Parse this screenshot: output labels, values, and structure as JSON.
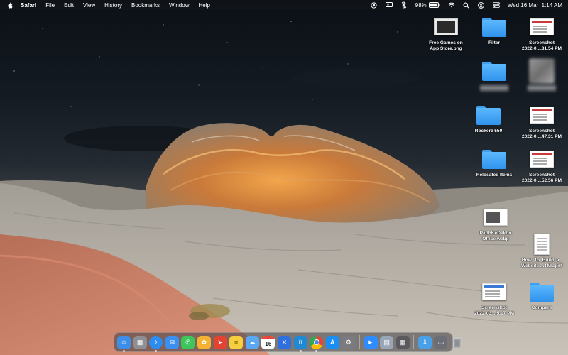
{
  "menubar": {
    "app_name": "Safari",
    "menus": [
      "File",
      "Edit",
      "View",
      "History",
      "Bookmarks",
      "Window",
      "Help"
    ],
    "battery": "98%",
    "datetime": "Wed 16 Mar  1:14 AM",
    "status_icons": [
      "screen-record-icon",
      "display-icon",
      "bluetooth-icon",
      "battery-icon",
      "wifi-icon",
      "search-icon",
      "user-icon",
      "control-center-icon"
    ]
  },
  "desktop": {
    "icons": [
      {
        "label": "Free Games on\nApp Store.png",
        "kind": "screenshot-dark"
      },
      {
        "label": "Filter",
        "kind": "folder"
      },
      {
        "label": "Screenshot\n2022-0....31.54 PM",
        "kind": "screenshot"
      },
      {
        "label": "",
        "kind": "folder-blurred"
      },
      {
        "label": "",
        "kind": "blurred"
      },
      {
        "label": "Rockerz 550",
        "kind": "folder"
      },
      {
        "label": "Screenshot\n2022-0....47.31 PM",
        "kind": "screenshot"
      },
      {
        "label": "Relocated Items",
        "kind": "folder"
      },
      {
        "label": "Screenshot\n2022-0....52.56 PM",
        "kind": "screenshot"
      },
      {
        "label": "PadhKeDekho\nOffice.webp",
        "kind": "screenshot-dark"
      },
      {
        "label": "How_To_Build_a_\nWebsite....TML.pdf",
        "kind": "pdf"
      },
      {
        "label": "Screenshot\n2022-03....5.17 PM",
        "kind": "screenshot"
      },
      {
        "label": "Compare",
        "kind": "folder"
      }
    ]
  },
  "dock": {
    "calendar_day": "16",
    "apps": [
      {
        "name": "Finder",
        "color": "#3c8ee8",
        "glyph": "☺"
      },
      {
        "name": "Launchpad",
        "color": "#8e8e93",
        "glyph": "▦"
      },
      {
        "name": "Safari",
        "color": "#2d8cf0",
        "glyph": "✧"
      },
      {
        "name": "Mail",
        "color": "#3a8ff0",
        "glyph": "✉"
      },
      {
        "name": "Messages",
        "color": "#3cc55a",
        "glyph": "✆"
      },
      {
        "name": "Photos",
        "color": "#f4b234",
        "glyph": "✿"
      },
      {
        "name": "Todoist",
        "color": "#e44332",
        "glyph": "➤"
      },
      {
        "name": "Notes",
        "color": "#f6cf3e",
        "glyph": "≡"
      },
      {
        "name": "iCloud Drive",
        "color": "#5aa7f2",
        "glyph": "☁"
      },
      {
        "name": "Calendar",
        "color": "#ffffff",
        "glyph": "16"
      },
      {
        "name": "Xcode",
        "color": "#2f6fe0",
        "glyph": "✕"
      },
      {
        "name": "VS Code",
        "color": "#1f8ad2",
        "glyph": "⟨⟩"
      },
      {
        "name": "Chrome",
        "color": "#e0e0e0",
        "glyph": "◉"
      },
      {
        "name": "App Store",
        "color": "#1a8ef5",
        "glyph": "A"
      },
      {
        "name": "System Preferences",
        "color": "#7b7b80",
        "glyph": "⚙"
      },
      {
        "name": "Zoom",
        "color": "#2d8cff",
        "glyph": "▶"
      },
      {
        "name": "Preview",
        "color": "#9aa6b5",
        "glyph": "▤"
      },
      {
        "name": "Calculator",
        "color": "#5a5a5e",
        "glyph": "▦"
      },
      {
        "name": "Downloads",
        "color": "#4aa0e8",
        "glyph": "⇩"
      },
      {
        "name": "Desktop Stack",
        "color": "#6b6e74",
        "glyph": "▭"
      },
      {
        "name": "Trash",
        "color": "#8a8d92",
        "glyph": "🗑"
      }
    ]
  }
}
